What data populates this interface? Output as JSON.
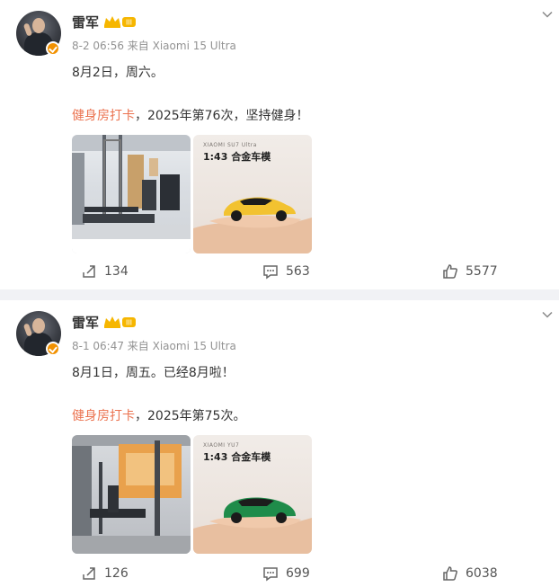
{
  "posts": [
    {
      "author": "雷军",
      "meta": "8-2 06:56 来自 Xiaomi 15 Ultra",
      "line1": "8月2日，周六。",
      "tag": "健身房打卡",
      "line2_rest": "，2025年第76次，坚持健身！",
      "model_card": {
        "brand": "XIAOMI SU7 Ultra",
        "title": "1:43 合金车模",
        "car_color": "#f2c230"
      },
      "reposts": "134",
      "comments": "563",
      "likes": "5577"
    },
    {
      "author": "雷军",
      "meta": "8-1 06:47 来自 Xiaomi 15 Ultra",
      "line1": "8月1日，周五。已经8月啦！",
      "tag": "健身房打卡",
      "line2_rest": "，2025年第75次。",
      "model_card": {
        "brand": "XIAOMI YU7",
        "title": "1:43 合金车模",
        "car_color": "#1f8c4a"
      },
      "reposts": "126",
      "comments": "699",
      "likes": "6038"
    }
  ],
  "colors": {
    "tag": "#eb7350",
    "verified_badge": "#f29100",
    "divider": "#f1f2f5"
  },
  "icons": {
    "expand": "chevron-down-icon",
    "repost": "repost-icon",
    "comment": "comment-icon",
    "like": "thumbs-up-icon"
  }
}
